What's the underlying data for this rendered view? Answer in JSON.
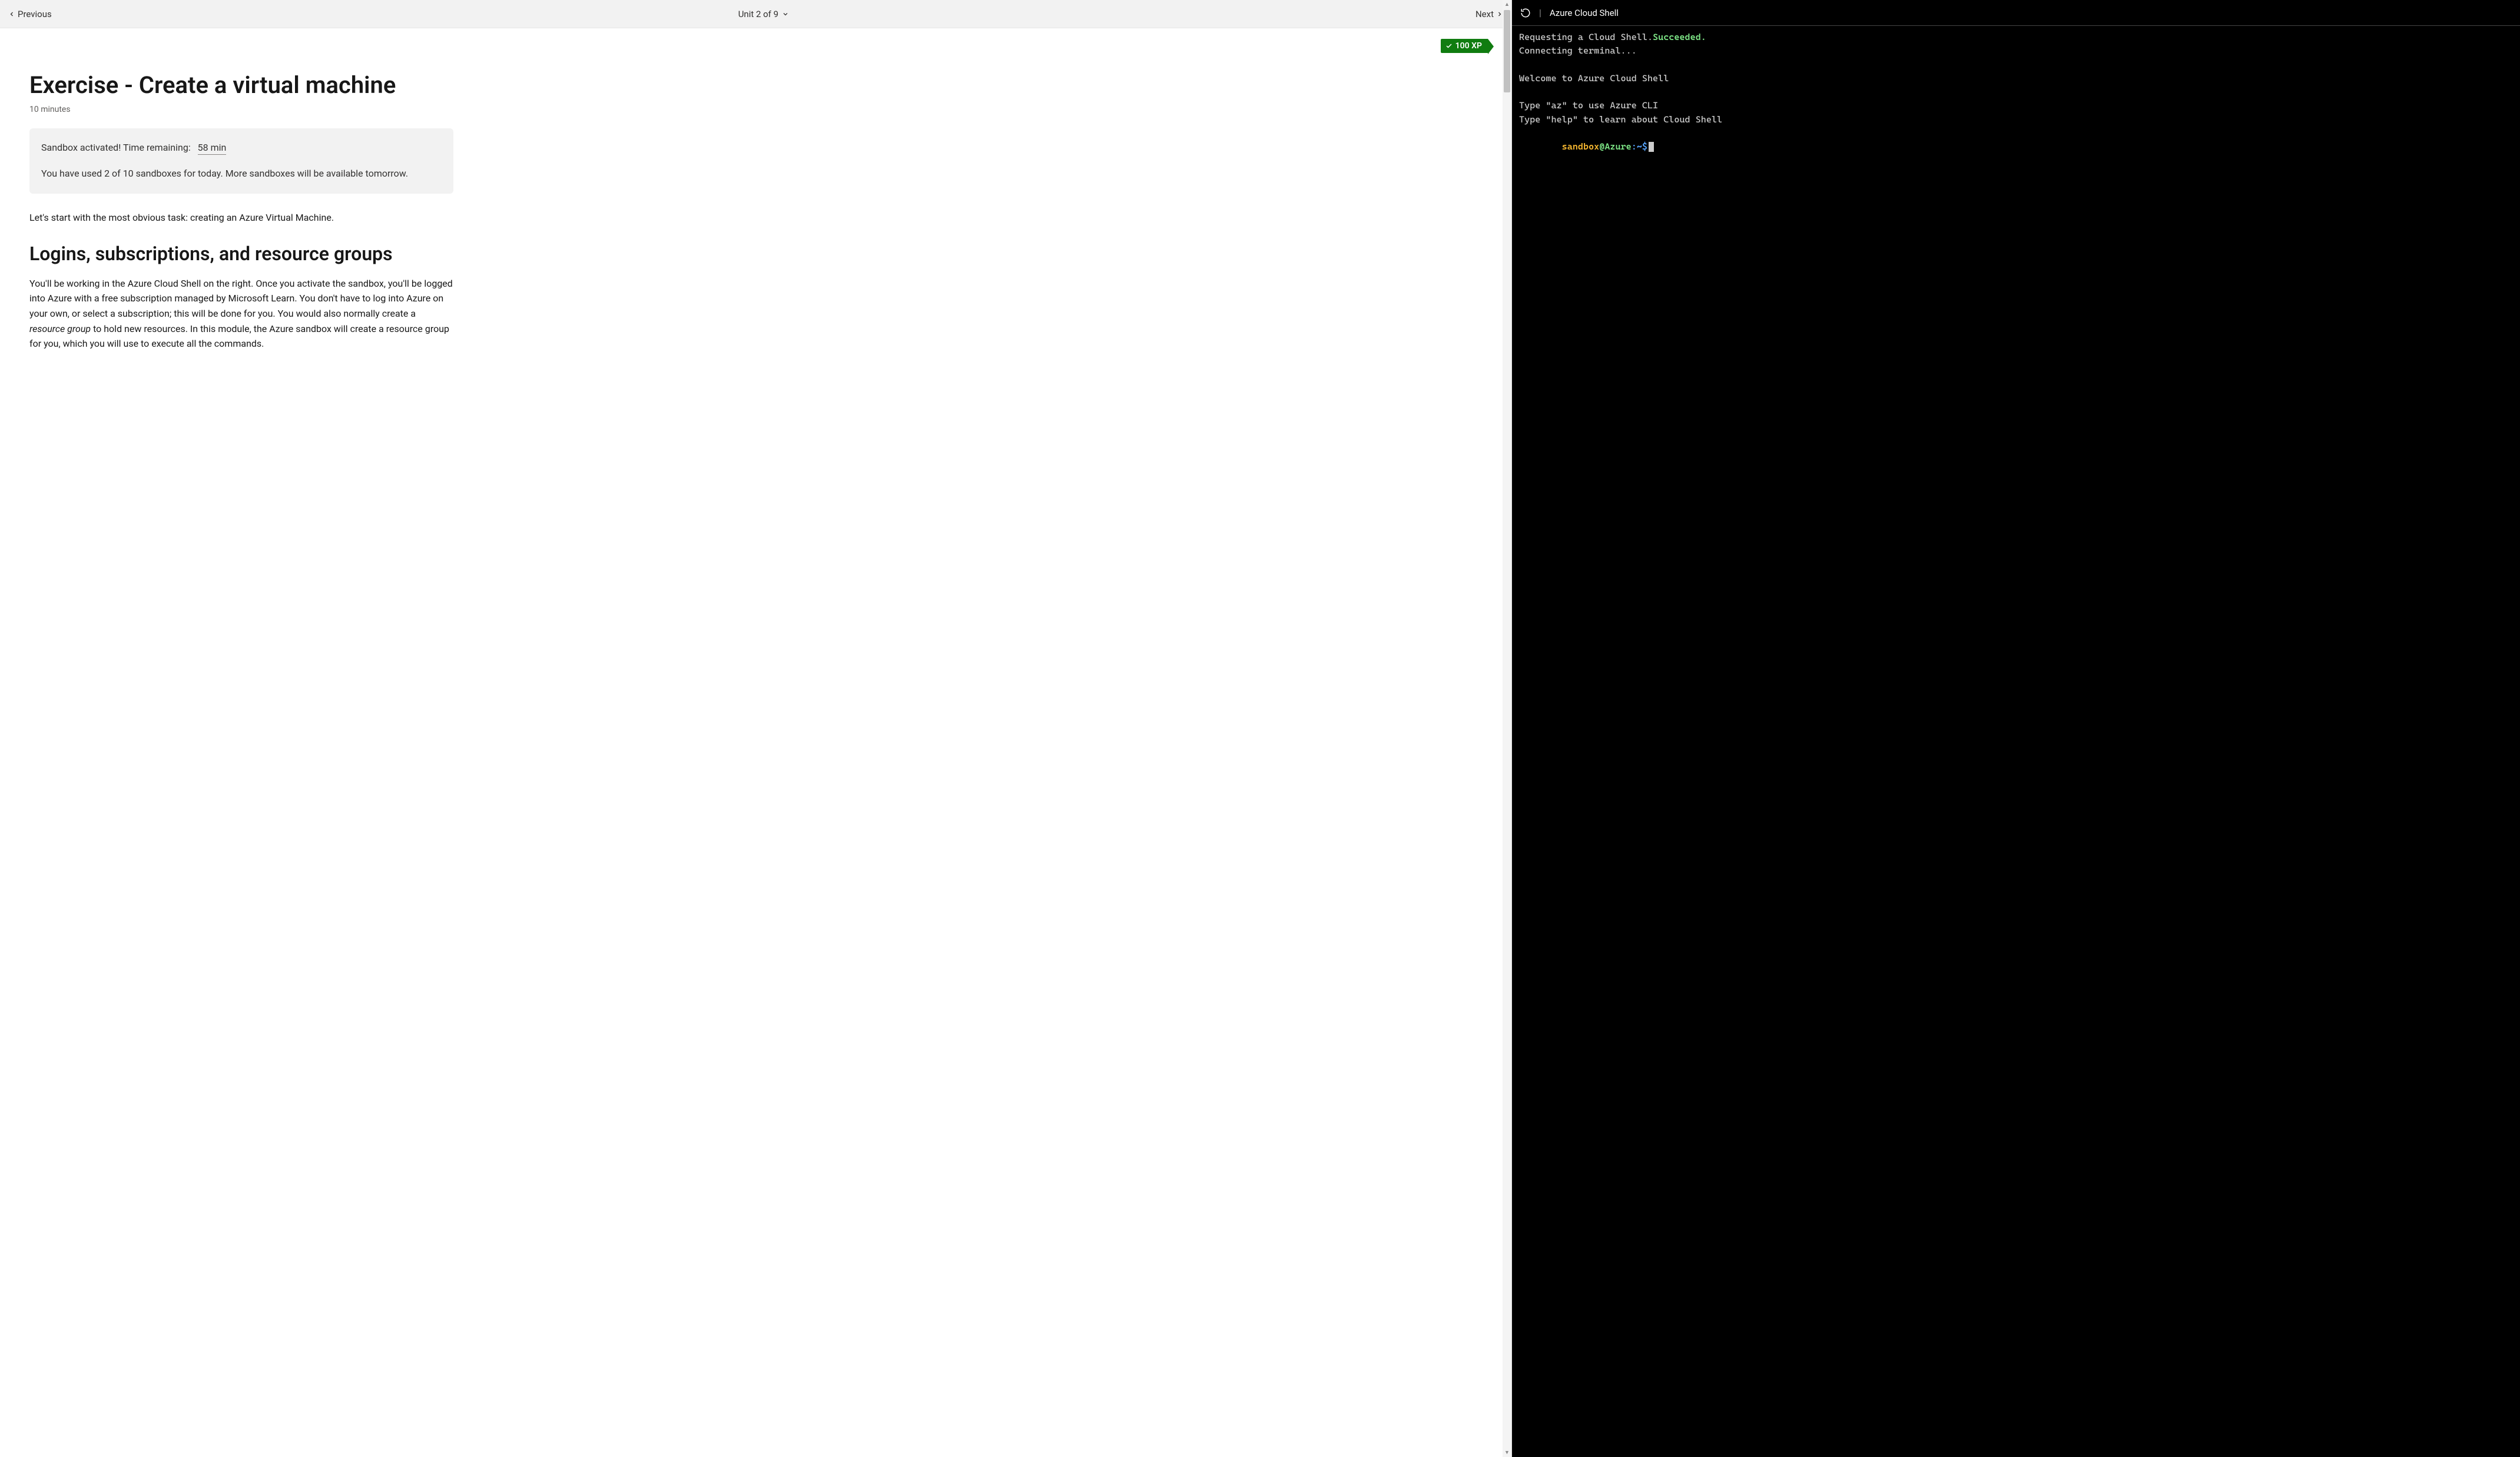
{
  "nav": {
    "previous_label": "Previous",
    "unit_label": "Unit 2 of 9",
    "next_label": "Next"
  },
  "xp": {
    "label": "100 XP"
  },
  "page": {
    "title": "Exercise - Create a virtual machine",
    "duration": "10 minutes",
    "sandbox_status": "Sandbox activated! Time remaining:",
    "sandbox_timer": "58 min",
    "sandbox_usage": "You have used 2 of 10 sandboxes for today. More sandboxes will be available tomorrow.",
    "intro_text": "Let's start with the most obvious task: creating an Azure Virtual Machine.",
    "section_heading": "Logins, subscriptions, and resource groups",
    "section_body_1": "You'll be working in the Azure Cloud Shell on the right. Once you activate the sandbox, you'll be logged into Azure with a free subscription managed by Microsoft Learn. You don't have to log into Azure on your own, or select a subscription; this will be done for you. You would also normally create a ",
    "section_body_italic": "resource group",
    "section_body_2": " to hold new resources. In this module, the Azure sandbox will create a resource group for you, which you will use to execute all the commands."
  },
  "terminal": {
    "header_title": "Azure Cloud Shell",
    "line1_a": "Requesting a Cloud Shell.",
    "line1_b": "Succeeded.",
    "line2": "Connecting terminal...",
    "line_blank": "",
    "line3": "Welcome to Azure Cloud Shell",
    "line4": "Type \"az\" to use Azure CLI",
    "line5": "Type \"help\" to learn about Cloud Shell",
    "prompt_indent": "        ",
    "prompt_sandbox": "sandbox",
    "prompt_at": "@Azure",
    "prompt_path": ":~$"
  }
}
